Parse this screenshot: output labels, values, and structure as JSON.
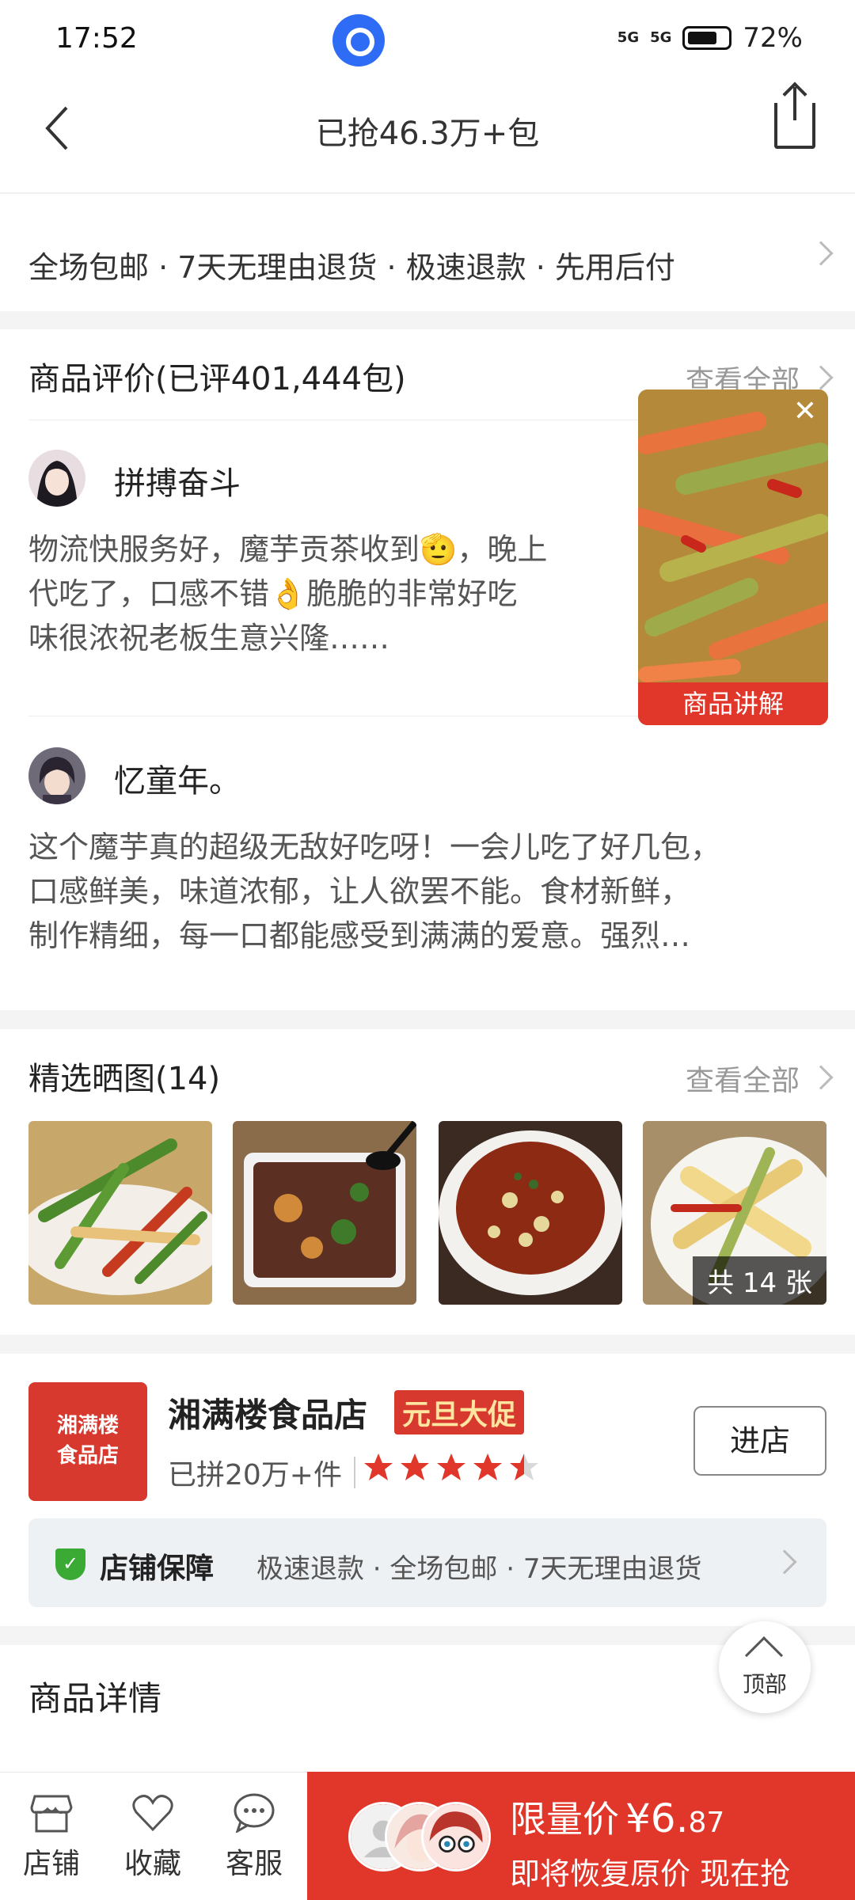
{
  "status_bar": {
    "time": "17:52",
    "signal_1": "5G",
    "signal_2": "5G",
    "battery": "72%"
  },
  "nav": {
    "title": "已抢46.3万+包",
    "back_icon": "chevron-left-icon",
    "share_icon": "share-icon"
  },
  "guarantee_bar": {
    "text": "全场包邮 · 7天无理由退货 · 极速退款 · 先用后付"
  },
  "reviews": {
    "title": "商品评价(已评401,444包)",
    "view_all": "查看全部",
    "items": [
      {
        "name": "拼搏奋斗",
        "text_1": "物流快服务好，魔芋贡茶收到🫡，晚上",
        "text_2": "代吃了，口感不错👌脆脆的非常好吃",
        "text_3": "味很浓祝老板生意兴隆……"
      },
      {
        "name": "忆童年。",
        "text_1": "这个魔芋真的超级无敌好吃呀！一会儿吃了好几包，",
        "text_2": "口感鲜美，味道浓郁，让人欲罢不能。食材新鲜，",
        "text_3": "制作精细，每一口都能感受到满满的爱意。强烈…"
      }
    ]
  },
  "video_popup": {
    "label": "商品讲解",
    "close": "✕"
  },
  "photos": {
    "title": "精选晒图(14)",
    "view_all": "查看全部",
    "count_label": "共 14 张"
  },
  "shop": {
    "logo_text": "湘满楼食品店",
    "name": "湘满楼食品店",
    "promo": "元旦大促",
    "sales": "已拼20万+件",
    "rating": 4.5,
    "enter": "进店",
    "guarantee_title": "店铺保障",
    "guarantee_items": "极速退款 · 全场包邮 · 7天无理由退货"
  },
  "details": {
    "title": "商品详情"
  },
  "top_button": {
    "label": "顶部"
  },
  "bottom_bar": {
    "store": "店铺",
    "favorite": "收藏",
    "service": "客服",
    "buy_label": "限量价",
    "buy_price": "¥6.",
    "buy_price_decimal": "87",
    "buy_sub": "即将恢复原价 现在抢"
  },
  "colors": {
    "accent_red": "#e0372a",
    "green": "#3aaa35"
  }
}
